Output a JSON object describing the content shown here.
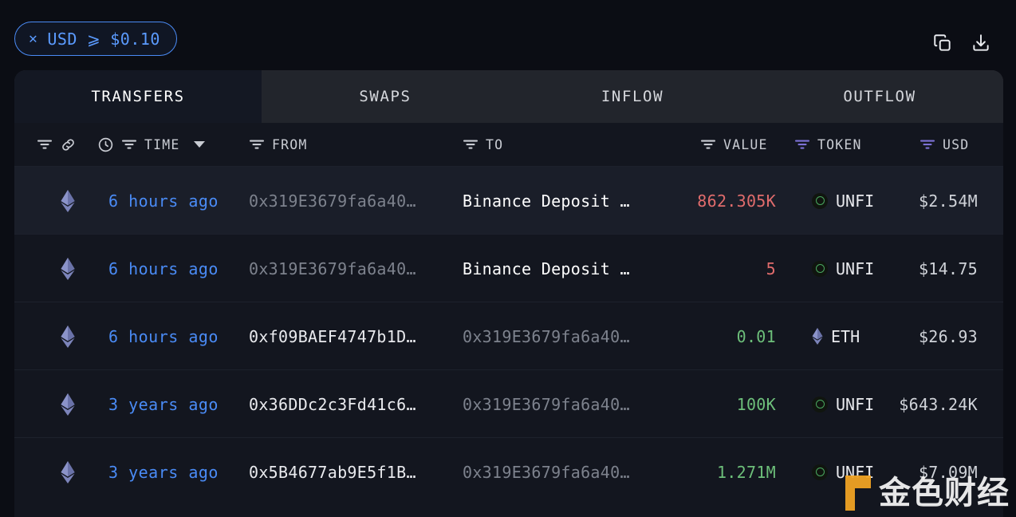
{
  "filter_chip": {
    "close_icon": "close-icon",
    "field": "USD",
    "operator": "⩾",
    "value": "$0.10"
  },
  "top_actions": [
    {
      "name": "copy-icon",
      "label": "Copy"
    },
    {
      "name": "download-icon",
      "label": "Download"
    }
  ],
  "tabs": [
    {
      "label": "TRANSFERS",
      "active": true
    },
    {
      "label": "SWAPS",
      "active": false
    },
    {
      "label": "INFLOW",
      "active": false
    },
    {
      "label": "OUTFLOW",
      "active": false
    }
  ],
  "columns": {
    "chain": "",
    "time": "TIME",
    "from": "FROM",
    "to": "TO",
    "value": "VALUE",
    "token": "TOKEN",
    "usd": "USD"
  },
  "colors": {
    "accent_blue": "#4a8bf5",
    "value_up": "#6dbf7a",
    "value_down": "#e06c6c",
    "filter_active_purple": "#7d72d6",
    "panel_bg": "#13161f",
    "tab_bar_bg": "#22252c",
    "page_bg": "#0b0d14",
    "token_green": "#4aa860",
    "watermark_orange": "#f0a324"
  },
  "rows": [
    {
      "chain": "ethereum-icon",
      "time": "6 hours ago",
      "from": "0x319E3679fa6a40…",
      "from_bright": false,
      "to": "Binance Deposit …",
      "to_bright": true,
      "value": "862.305K",
      "value_dir": "down",
      "token": "UNFI",
      "token_icon": "unfi-token-icon",
      "usd": "$2.54M",
      "highlight": true
    },
    {
      "chain": "ethereum-icon",
      "time": "6 hours ago",
      "from": "0x319E3679fa6a40…",
      "from_bright": false,
      "to": "Binance Deposit …",
      "to_bright": true,
      "value": "5",
      "value_dir": "down",
      "token": "UNFI",
      "token_icon": "unfi-token-icon",
      "usd": "$14.75",
      "highlight": false
    },
    {
      "chain": "ethereum-icon",
      "time": "6 hours ago",
      "from": "0xf09BAEF4747b1D…",
      "from_bright": true,
      "to": "0x319E3679fa6a40…",
      "to_bright": false,
      "value": "0.01",
      "value_dir": "up",
      "token": "ETH",
      "token_icon": "ethereum-token-icon",
      "usd": "$26.93",
      "highlight": false
    },
    {
      "chain": "ethereum-icon",
      "time": "3 years ago",
      "from": "0x36DDc2c3Fd41c6…",
      "from_bright": true,
      "to": "0x319E3679fa6a40…",
      "to_bright": false,
      "value": "100K",
      "value_dir": "up",
      "token": "UNFI",
      "token_icon": "unfi-token-icon",
      "usd": "$643.24K",
      "highlight": false
    },
    {
      "chain": "ethereum-icon",
      "time": "3 years ago",
      "from": "0x5B4677ab9E5f1B…",
      "from_bright": true,
      "to": "0x319E3679fa6a40…",
      "to_bright": false,
      "value": "1.271M",
      "value_dir": "up",
      "token": "UNFI",
      "token_icon": "unfi-token-icon",
      "usd": "$7.09M",
      "highlight": false
    }
  ],
  "watermark": {
    "text": "金色财经"
  }
}
